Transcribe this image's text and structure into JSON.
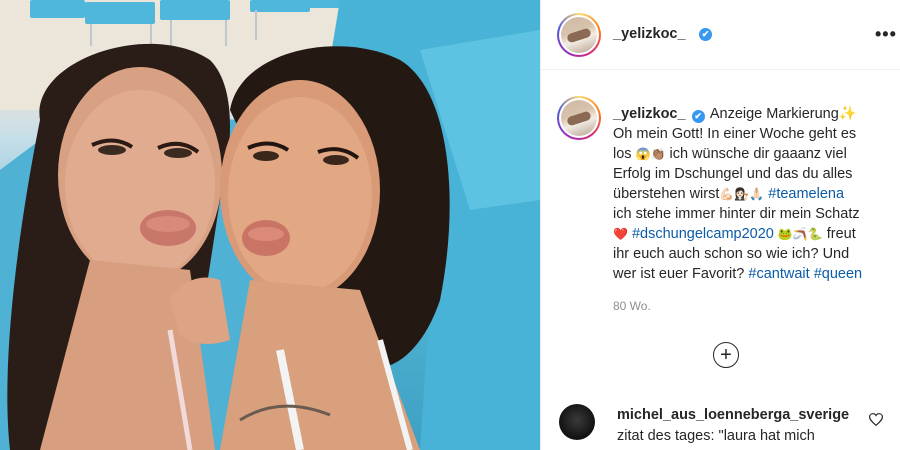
{
  "post": {
    "author": "_yelizkoc_",
    "verified_mark": "✔",
    "more_label": "•••",
    "caption": {
      "author": "_yelizkoc_",
      "line1": "Anzeige Markierung✨",
      "line2": "Oh mein Gott! In einer Woche geht es",
      "line3_a": "los ",
      "line3_emoji": "😱👏🏽",
      "line3_b": " ich wünsche dir gaaanz viel",
      "line4": "Erfolg im Dschungel und das du alles",
      "line5_a": "überstehen wirst",
      "line5_emoji": "💪🏻👩🏻‍⚖️🙏🏻",
      "line5_tag": "#teamelena",
      "line6": "ich stehe immer hinter dir mein Schatz",
      "line7_emoji": "❤️",
      "line7_tag": "#dschungelcamp2020",
      "line7_emoji2": "🐸🪃🐍",
      "line7_b": " freut",
      "line8": "ihr euch auch schon so wie ich? Und",
      "line9_a": "wer ist euer Favorit? ",
      "line9_tag1": "#cantwait",
      "line9_tag2": "#queen"
    },
    "timestamp": "80 Wo.",
    "load_more_label": "+"
  },
  "comments": [
    {
      "user": "michel_aus_loenneberga_sverige",
      "text": "zitat des tages: \"laura hat mich"
    }
  ],
  "icons": {
    "more": "more-options-icon",
    "verified": "verified-badge-icon",
    "load_more": "plus-circle-icon",
    "like": "heart-icon"
  },
  "colors": {
    "verified": "#3897f0",
    "hashtag": "#0b5ca8",
    "text": "#262626",
    "muted": "#8e8e8e"
  }
}
